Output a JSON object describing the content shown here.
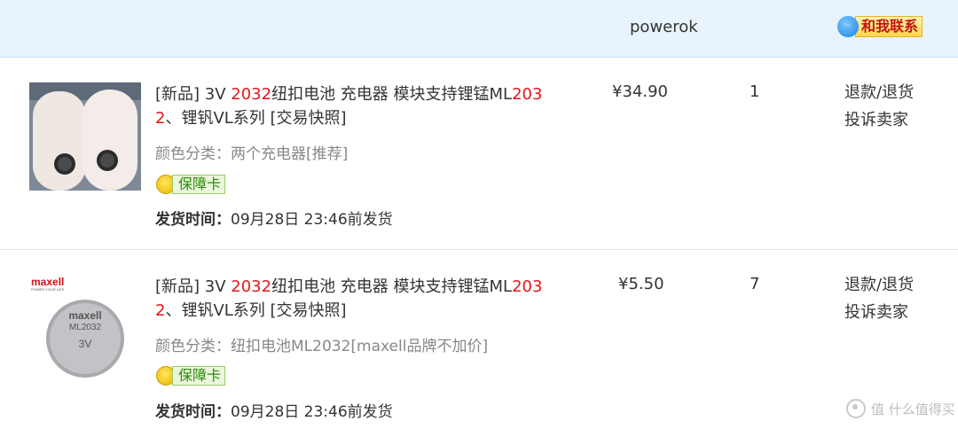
{
  "header": {
    "seller": "powerok",
    "contact_label": "和我联系",
    "contact_bubble": "··"
  },
  "items": [
    {
      "title_parts": [
        "[新品] 3V ",
        "2032",
        "纽扣电池 充电器 模块支持锂锰ML",
        "203",
        "",
        "2",
        "、锂钒VL系列 [交易快照]"
      ],
      "attr": "颜色分类：两个充电器[推荐]",
      "badge": "保障卡",
      "ship_label": "发货时间：",
      "ship_value": "09月28日 23:46前发货",
      "price": "¥34.90",
      "qty": "1",
      "action1": "退款/退货",
      "action2": "投诉卖家"
    },
    {
      "title_parts": [
        "[新品] 3V ",
        "2032",
        "纽扣电池 充电器 模块支持锂锰ML",
        "203",
        "",
        "2",
        "、锂钒VL系列 [交易快照]"
      ],
      "attr": "颜色分类：纽扣电池ML2032[maxell品牌不加价]",
      "badge": "保障卡",
      "ship_label": "发货时间：",
      "ship_value": "09月28日 23:46前发货",
      "price": "¥5.50",
      "qty": "7",
      "action1": "退款/退货",
      "action2": "投诉卖家",
      "thumb_brand": "maxell",
      "thumb_brand_sub": "POWER YOUR LIFE",
      "thumb_cell_brand": "maxell",
      "thumb_cell_model": "ML2032",
      "thumb_cell_volt": "3V"
    }
  ],
  "watermark": "值 什么值得买"
}
